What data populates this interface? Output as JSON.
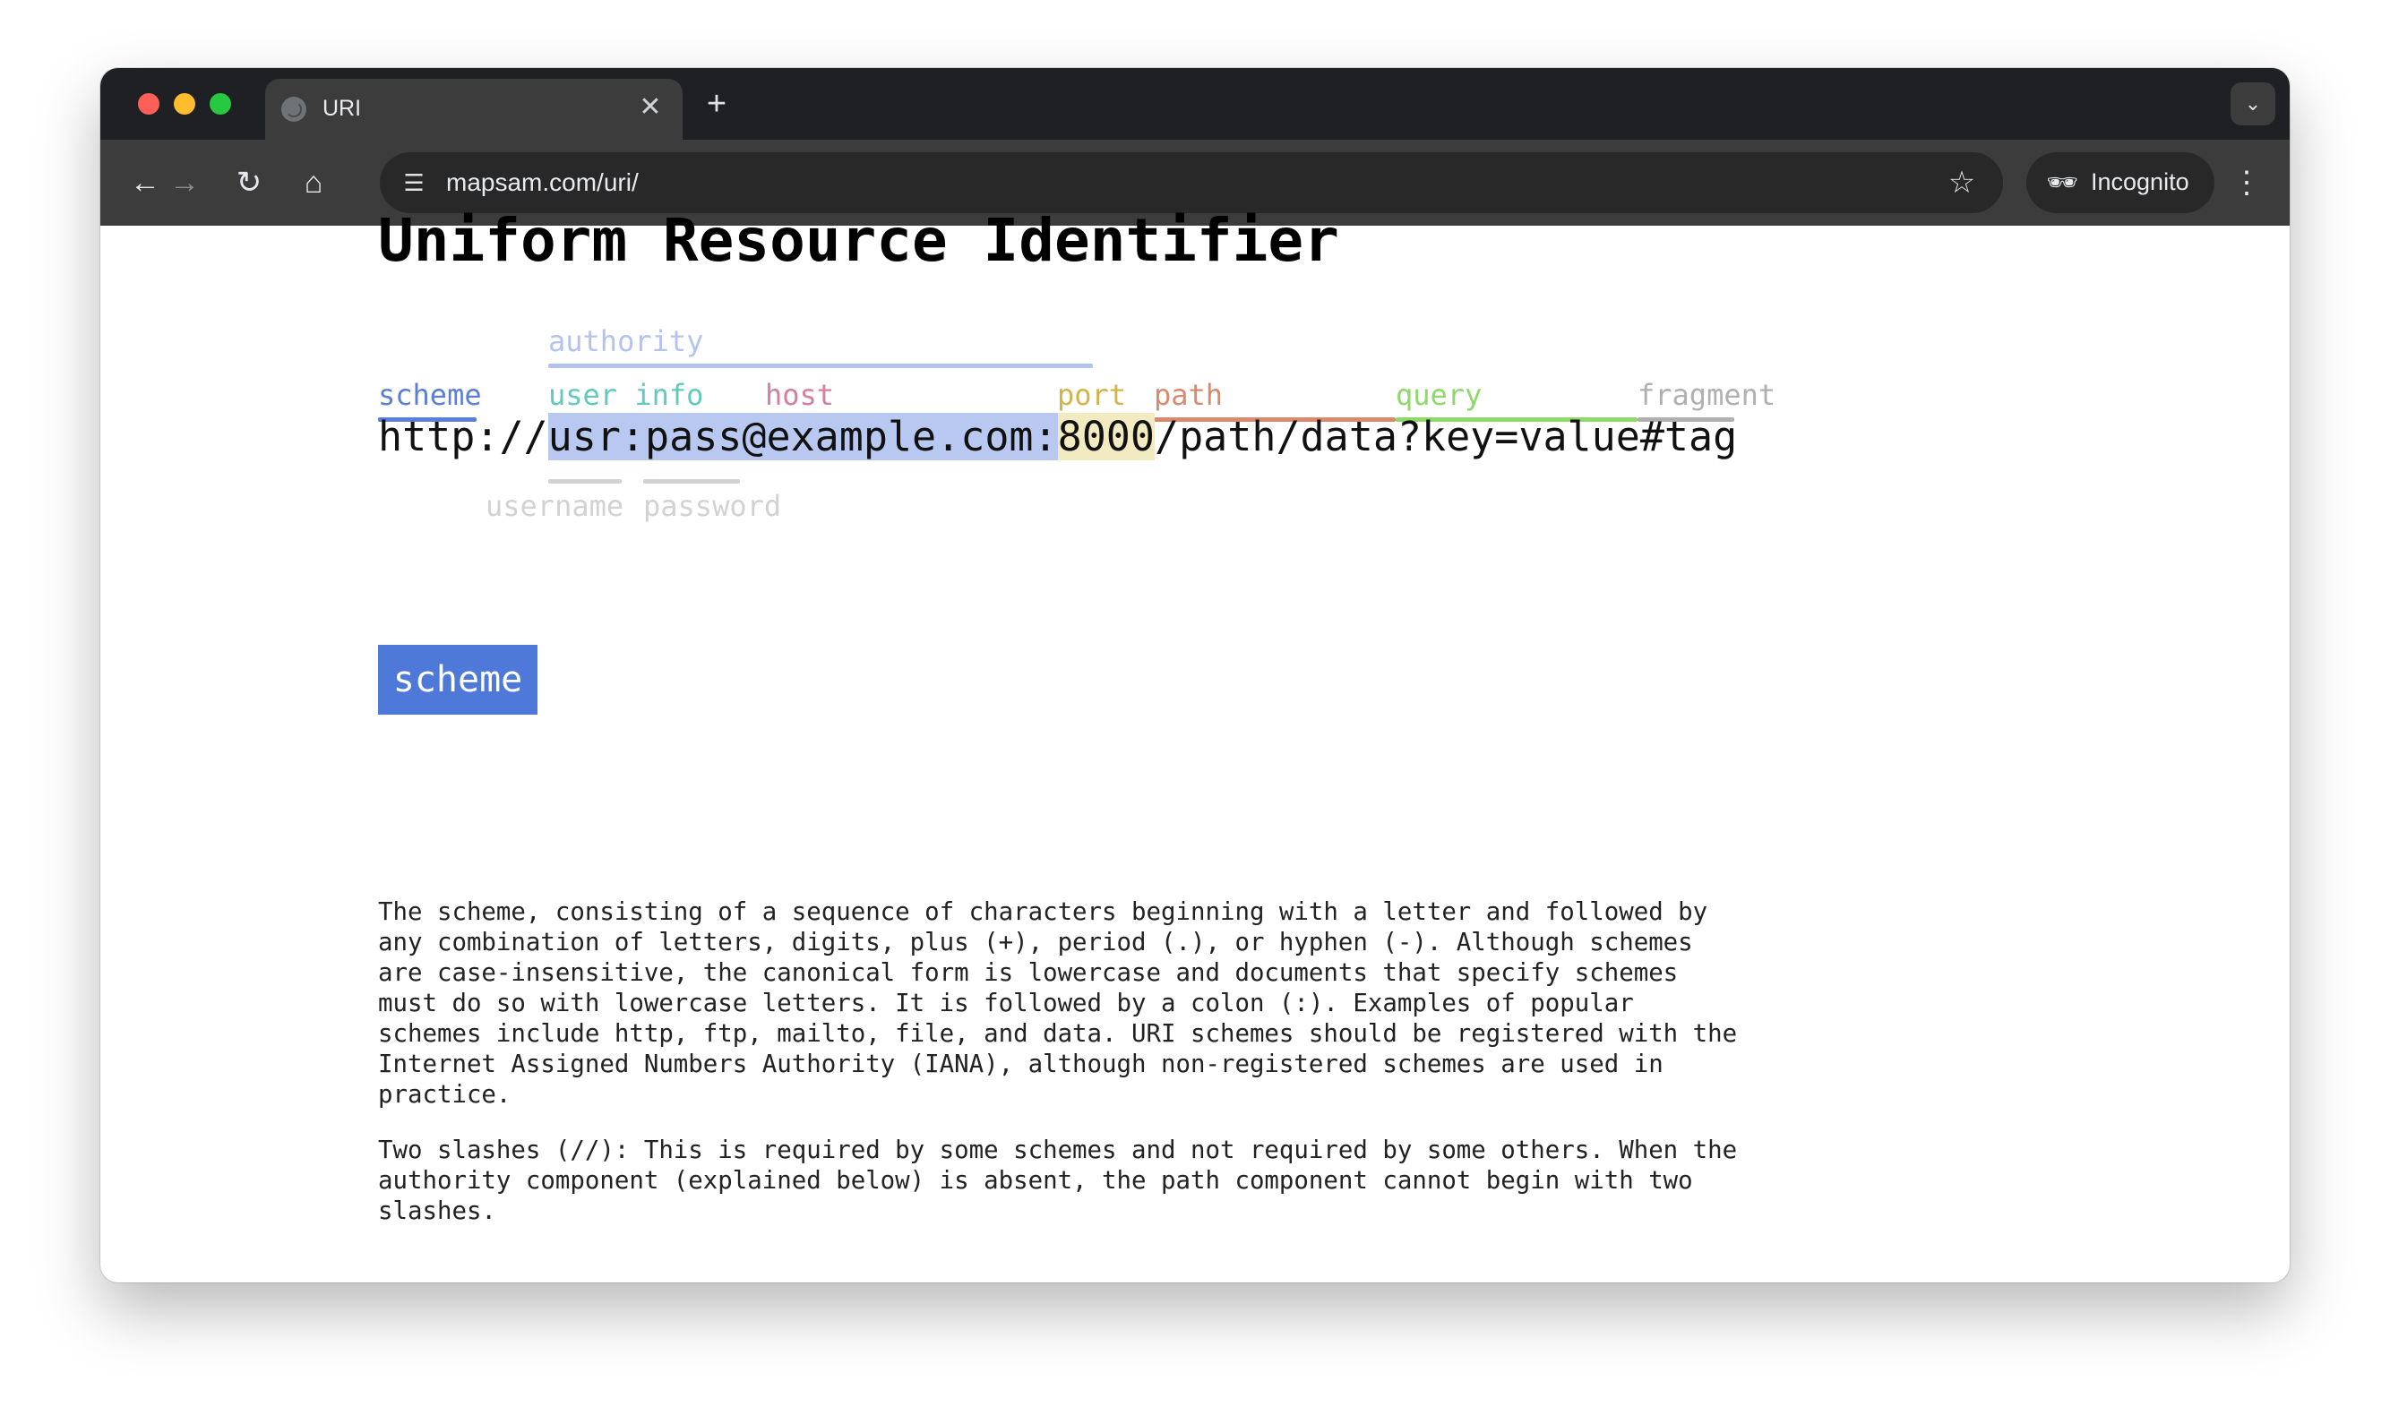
{
  "browser": {
    "tab_title": "URI",
    "new_tab_icon": "plus-icon",
    "url": "mapsam.com/uri/",
    "incognito_label": "Incognito"
  },
  "page": {
    "title": "Uniform Resource Identifier",
    "diagram": {
      "uri": {
        "scheme_part": "http://",
        "userinfo_part": "usr:pass",
        "at_host_part": "@example.com:",
        "port_part": "8000",
        "rest_part": "/path/data?key=value#tag"
      },
      "labels": {
        "authority": "authority",
        "scheme": "scheme",
        "user_info": "user info",
        "host": "host",
        "port": "port",
        "path": "path",
        "query": "query",
        "fragment": "fragment",
        "username": "username",
        "password": "password"
      },
      "colors": {
        "authority": "#b4c3ee",
        "scheme": "#5b7fd6",
        "user_info": "#62c9bd",
        "host": "#d47fa0",
        "port": "#d4b44a",
        "path": "#d98a6e",
        "query": "#8fd86a",
        "fragment": "#b0b0b0",
        "sub": "#d2d2d2"
      }
    },
    "section": {
      "heading": "scheme",
      "paragraphs": [
        "The scheme, consisting of a sequence of characters beginning with a letter and followed by\nany combination of letters, digits, plus (+), period (.), or hyphen (-). Although schemes\nare case-insensitive, the canonical form is lowercase and documents that specify schemes\nmust do so with lowercase letters. It is followed by a colon (:). Examples of popular\nschemes include http, ftp, mailto, file, and data. URI schemes should be registered with the\nInternet Assigned Numbers Authority (IANA), although non-registered schemes are used in\npractice.",
        "Two slashes (//): This is required by some schemes and not required by some others. When the\nauthority component (explained below) is absent, the path component cannot begin with two\nslashes."
      ]
    }
  }
}
